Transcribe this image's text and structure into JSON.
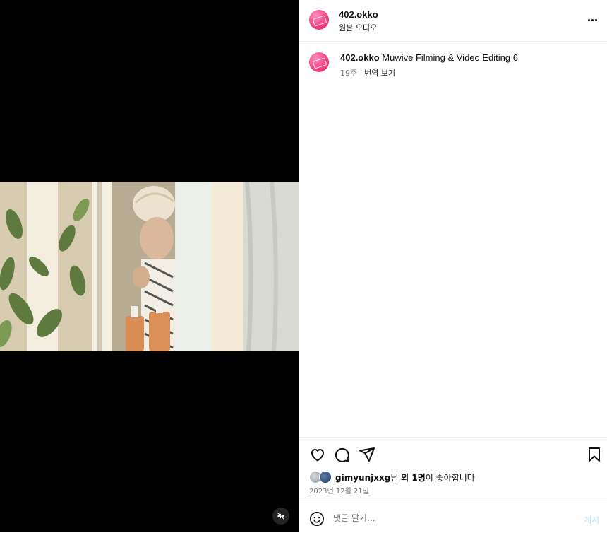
{
  "post": {
    "username": "402.okko",
    "audio_label": "원본 오디오"
  },
  "caption": {
    "username": "402.okko",
    "text": "Muwive Filming & Video Editing 6",
    "age": "19주",
    "translate": "번역 보기"
  },
  "likes": {
    "liker": "gimyunjxxg",
    "suffix_nim": "님 ",
    "and_others": "외 1명",
    "suffix_like": "이 좋아합니다"
  },
  "date": "2023년 12월 21일",
  "comment": {
    "placeholder": "댓글 달기...",
    "post_label": "게시"
  },
  "icons": {
    "more": "more-options-icon",
    "like": "heart-icon",
    "comment": "comment-icon",
    "share": "share-icon",
    "save": "bookmark-icon",
    "emoji": "emoji-icon",
    "mute": "muted-speaker-icon"
  },
  "colors": {
    "video_bg": "#000000",
    "avatar_pink": "#f0407e",
    "muted_text": "#737373",
    "post_button": "#b2dffc"
  }
}
